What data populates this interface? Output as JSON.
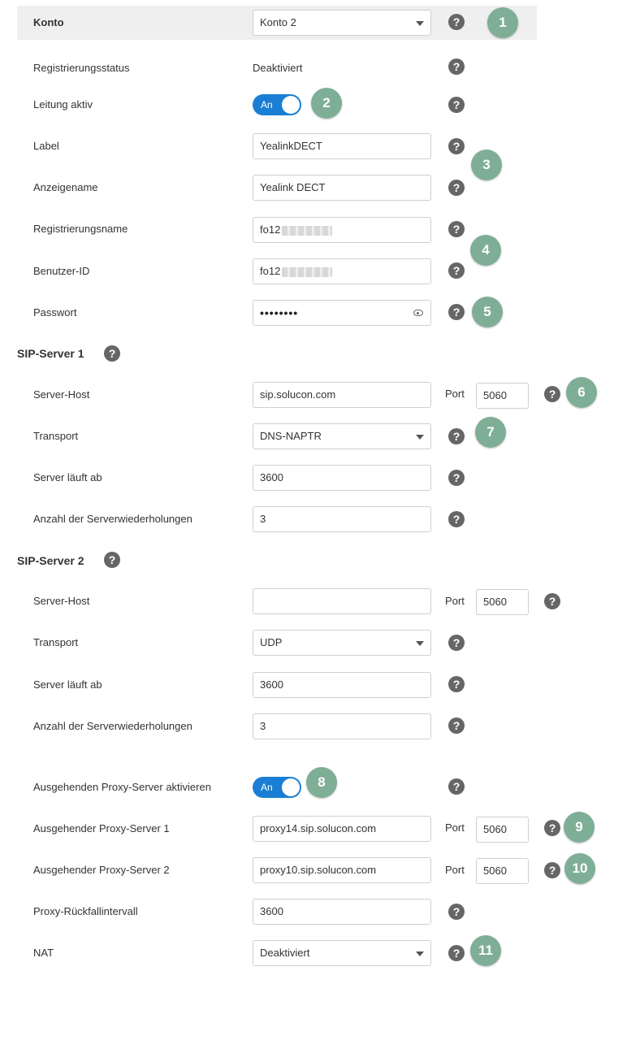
{
  "header": {
    "label": "Konto",
    "account_value": "Konto 2"
  },
  "rows": {
    "reg_status": {
      "label": "Registrierungsstatus",
      "value": "Deaktiviert"
    },
    "line_active": {
      "label": "Leitung aktiv",
      "toggle": "An"
    },
    "label": {
      "label": "Label",
      "value": "YealinkDECT"
    },
    "display_name": {
      "label": "Anzeigename",
      "value": "Yealink DECT"
    },
    "register_name": {
      "label": "Registrierungsname",
      "value": "fo12"
    },
    "user_id": {
      "label": "Benutzer-ID",
      "value": "fo12"
    },
    "password": {
      "label": "Passwort",
      "value": "••••••••"
    }
  },
  "sip1": {
    "title": "SIP-Server 1",
    "server_host": {
      "label": "Server-Host",
      "value": "sip.solucon.com",
      "port_label": "Port",
      "port": "5060"
    },
    "transport": {
      "label": "Transport",
      "value": "DNS-NAPTR"
    },
    "expires": {
      "label": "Server läuft ab",
      "value": "3600"
    },
    "retries": {
      "label": "Anzahl der Serverwiederholungen",
      "value": "3"
    }
  },
  "sip2": {
    "title": "SIP-Server 2",
    "server_host": {
      "label": "Server-Host",
      "value": "",
      "port_label": "Port",
      "port": "5060"
    },
    "transport": {
      "label": "Transport",
      "value": "UDP"
    },
    "expires": {
      "label": "Server läuft ab",
      "value": "3600"
    },
    "retries": {
      "label": "Anzahl der Serverwiederholungen",
      "value": "3"
    }
  },
  "proxy": {
    "enable": {
      "label": "Ausgehenden Proxy-Server aktivieren",
      "toggle": "An"
    },
    "server1": {
      "label": "Ausgehender Proxy-Server 1",
      "value": "proxy14.sip.solucon.com",
      "port_label": "Port",
      "port": "5060"
    },
    "server2": {
      "label": "Ausgehender Proxy-Server 2",
      "value": "proxy10.sip.solucon.com",
      "port_label": "Port",
      "port": "5060"
    },
    "fallback": {
      "label": "Proxy-Rückfallintervall",
      "value": "3600"
    }
  },
  "nat": {
    "label": "NAT",
    "value": "Deaktiviert"
  },
  "help_glyph": "?",
  "badges": [
    "1",
    "2",
    "3",
    "4",
    "5",
    "6",
    "7",
    "8",
    "9",
    "10",
    "11"
  ],
  "icons": {
    "help": "question-circle-icon",
    "eye": "eye-icon",
    "caret": "chevron-down-icon"
  },
  "colors": {
    "badge": "#7fae97",
    "toggle": "#1a7fd4",
    "help": "#666666",
    "header_band": "#efefef"
  }
}
